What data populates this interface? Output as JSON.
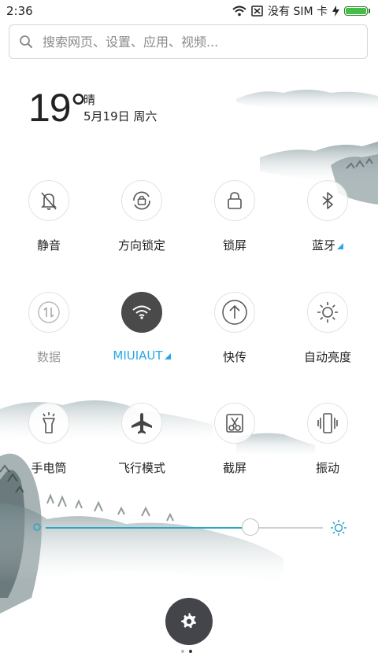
{
  "status": {
    "time": "2:36",
    "carrier_text": "没有 SIM 卡",
    "battery_level": 1.0,
    "battery_color": "#43c043"
  },
  "search": {
    "placeholder": "搜索网页、设置、应用、视频..."
  },
  "weather": {
    "temperature": "19°",
    "condition": "晴",
    "date": "5月19日 周六"
  },
  "toggles": [
    {
      "label": "静音",
      "icon": "bell-off-icon",
      "state": "off"
    },
    {
      "label": "方向锁定",
      "icon": "rotation-lock-icon",
      "state": "off"
    },
    {
      "label": "锁屏",
      "icon": "lock-icon",
      "state": "off"
    },
    {
      "label": "蓝牙",
      "icon": "bluetooth-icon",
      "state": "off",
      "has_submenu": true
    },
    {
      "label": "数据",
      "icon": "data-arrows-icon",
      "state": "disabled"
    },
    {
      "label": "MIUIAUT",
      "icon": "wifi-icon",
      "state": "on",
      "has_submenu": true
    },
    {
      "label": "快传",
      "icon": "upload-arrow-icon",
      "state": "off"
    },
    {
      "label": "自动亮度",
      "icon": "sun-icon",
      "state": "off"
    },
    {
      "label": "手电筒",
      "icon": "flashlight-icon",
      "state": "off"
    },
    {
      "label": "飞行模式",
      "icon": "airplane-icon",
      "state": "off"
    },
    {
      "label": "截屏",
      "icon": "scissors-icon",
      "state": "off"
    },
    {
      "label": "振动",
      "icon": "vibrate-icon",
      "state": "off"
    }
  ],
  "brightness": {
    "level": 0.74,
    "accent_color": "#2ba5c9"
  },
  "pager": {
    "pages": 2,
    "current": 2
  },
  "colors": {
    "accent": "#29a7e1",
    "active_toggle": "#4a4a4a",
    "settings_button": "#43454a"
  }
}
